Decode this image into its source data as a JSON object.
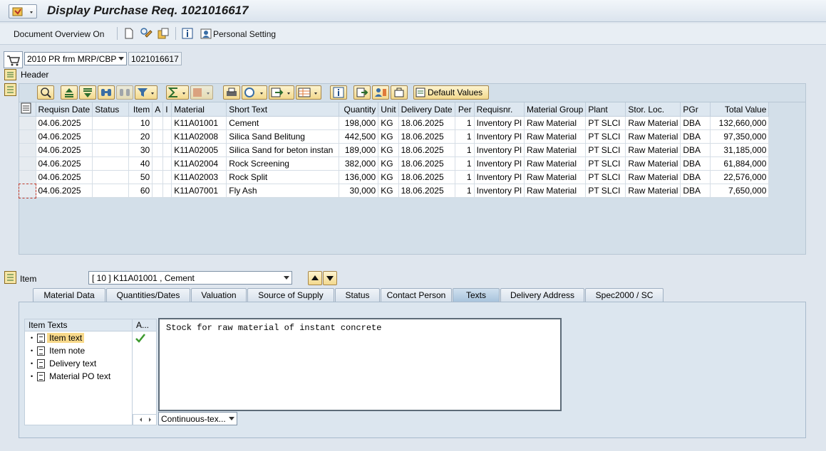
{
  "window": {
    "title": "Display Purchase Req. 1021016617"
  },
  "toolbar": {
    "document_overview": "Document Overview On",
    "personal_setting": "Personal Setting"
  },
  "doc_type": {
    "value": "2010 PR frm MRP/CBP",
    "number": "1021016617"
  },
  "header": {
    "label": "Header"
  },
  "grid_toolbar": {
    "default_values": "Default Values"
  },
  "table": {
    "columns": [
      "Requisn Date",
      "Status",
      "Item",
      "A",
      "I",
      "Material",
      "Short Text",
      "Quantity",
      "Unit",
      "Delivery Date",
      "Per",
      "Requisnr.",
      "Material Group",
      "Plant",
      "Stor. Loc.",
      "PGr",
      "Total Value"
    ],
    "rows": [
      [
        "04.06.2025",
        "",
        "10",
        "",
        "",
        "K11A01001",
        "Cement",
        "198,000",
        "KG",
        "18.06.2025",
        "1",
        "Inventory Pl",
        "Raw Material",
        "PT SLCI",
        "Raw Material",
        "DBA",
        "132,660,000"
      ],
      [
        "04.06.2025",
        "",
        "20",
        "",
        "",
        "K11A02008",
        "Silica Sand Belitung",
        "442,500",
        "KG",
        "18.06.2025",
        "1",
        "Inventory Pl",
        "Raw Material",
        "PT SLCI",
        "Raw Material",
        "DBA",
        "97,350,000"
      ],
      [
        "04.06.2025",
        "",
        "30",
        "",
        "",
        "K11A02005",
        "Silica Sand for beton instan",
        "189,000",
        "KG",
        "18.06.2025",
        "1",
        "Inventory Pl",
        "Raw Material",
        "PT SLCI",
        "Raw Material",
        "DBA",
        "31,185,000"
      ],
      [
        "04.06.2025",
        "",
        "40",
        "",
        "",
        "K11A02004",
        "Rock Screening",
        "382,000",
        "KG",
        "18.06.2025",
        "1",
        "Inventory Pl",
        "Raw Material",
        "PT SLCI",
        "Raw Material",
        "DBA",
        "61,884,000"
      ],
      [
        "04.06.2025",
        "",
        "50",
        "",
        "",
        "K11A02003",
        "Rock Split",
        "136,000",
        "KG",
        "18.06.2025",
        "1",
        "Inventory Pl",
        "Raw Material",
        "PT SLCI",
        "Raw Material",
        "DBA",
        "22,576,000"
      ],
      [
        "04.06.2025",
        "",
        "60",
        "",
        "",
        "K11A07001",
        "Fly Ash",
        "30,000",
        "KG",
        "18.06.2025",
        "1",
        "Inventory Pl",
        "Raw Material",
        "PT SLCI",
        "Raw Material",
        "DBA",
        "7,650,000"
      ]
    ]
  },
  "item": {
    "label": "Item",
    "selected": "[ 10 ] K11A01001 , Cement"
  },
  "tabs": [
    "Material Data",
    "Quantities/Dates",
    "Valuation",
    "Source of Supply",
    "Status",
    "Contact Person",
    "Texts",
    "Delivery Address",
    "Spec2000 / SC"
  ],
  "texts_panel": {
    "tree_header": "Item Texts",
    "col2_header": "A...",
    "items": [
      "Item text",
      "Item note",
      "Delivery text",
      "Material PO text"
    ],
    "text_content": "Stock for raw material of instant concrete",
    "format": "Continuous-tex..."
  },
  "colors": {
    "accent": "#f3d98d",
    "check": "#3d9a2f"
  }
}
